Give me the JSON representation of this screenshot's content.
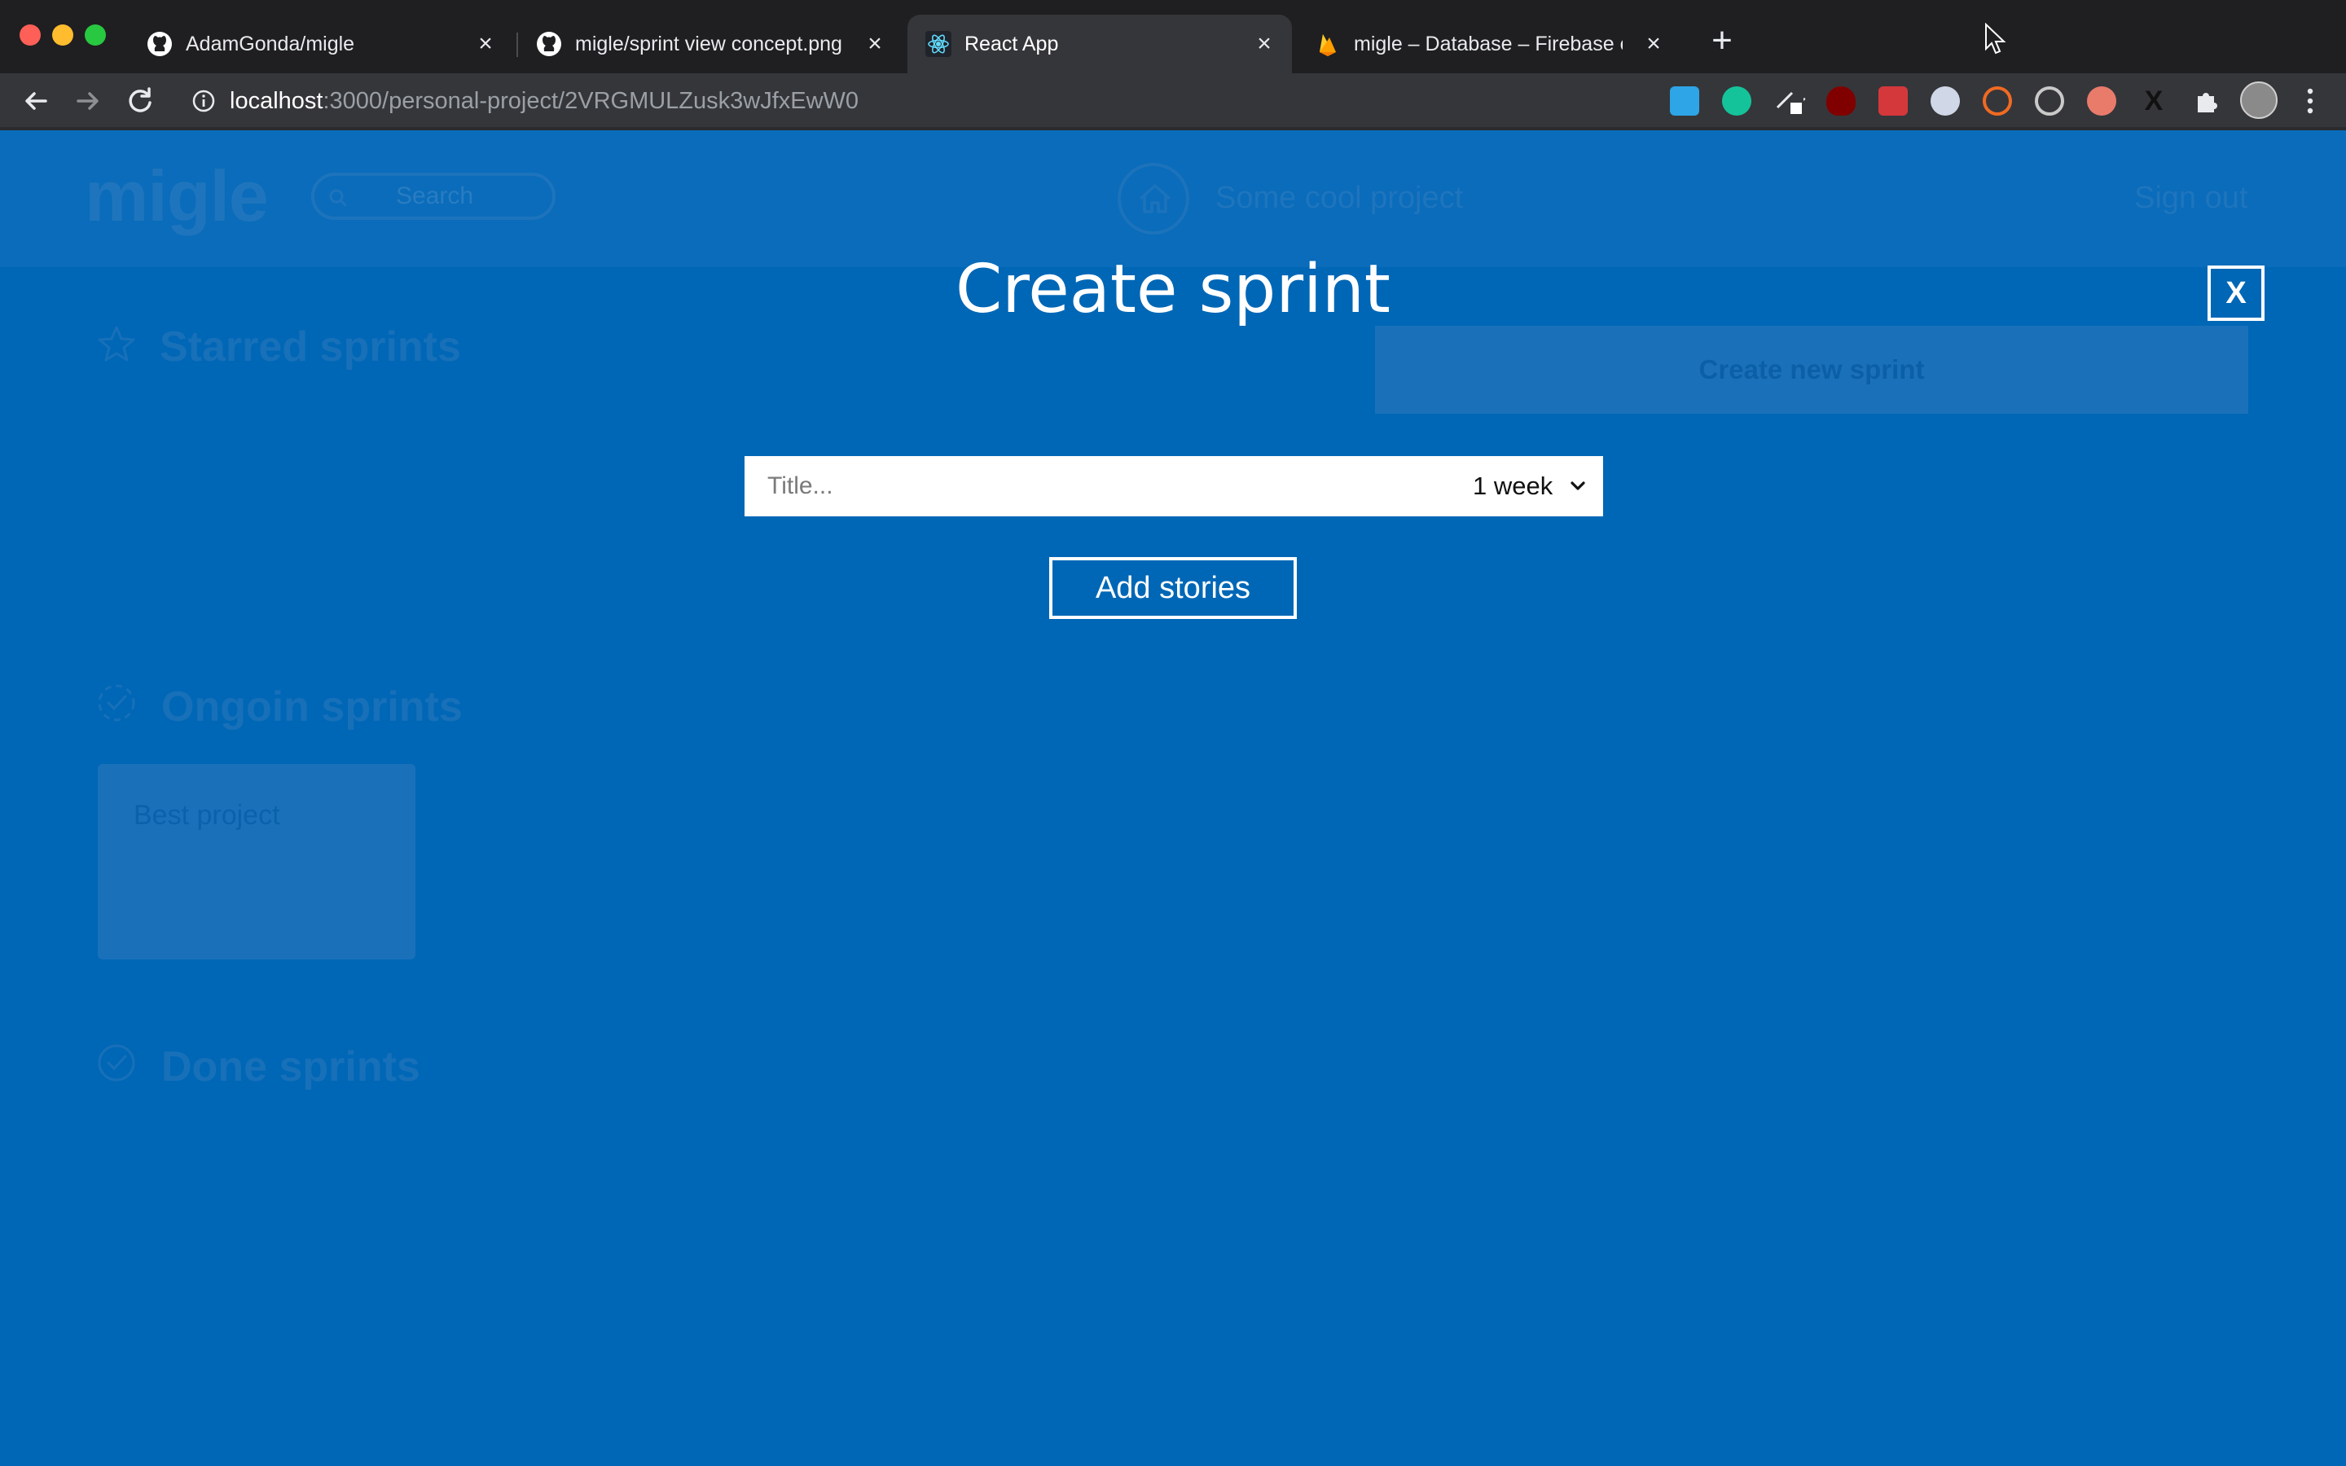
{
  "browser": {
    "tabs": [
      {
        "title": "AdamGonda/migle",
        "icon": "github-icon"
      },
      {
        "title": "migle/sprint view concept.png",
        "icon": "github-icon"
      },
      {
        "title": "React App",
        "icon": "react-icon",
        "active": true
      },
      {
        "title": "migle – Database – Firebase co",
        "icon": "firebase-icon"
      }
    ],
    "url_host": "localhost",
    "url_path": ":3000/personal-project/2VRGMULZusk3wJfxEwW0"
  },
  "header": {
    "logo": "migle",
    "search_placeholder": "Search",
    "project_name": "Some cool project",
    "sign_out": "Sign out"
  },
  "sections": {
    "starred": "Starred sprints",
    "ongoing": "Ongoin sprints",
    "done": "Done sprints"
  },
  "create_new_sprint": "Create new sprint",
  "cards": [
    {
      "title": "Best project"
    }
  ],
  "modal": {
    "title": "Create sprint",
    "close_label": "X",
    "title_placeholder": "Title...",
    "duration_value": "1 week",
    "add_stories_label": "Add stories"
  },
  "colors": {
    "background": "#0067b6",
    "modal_text": "#ffffff"
  }
}
